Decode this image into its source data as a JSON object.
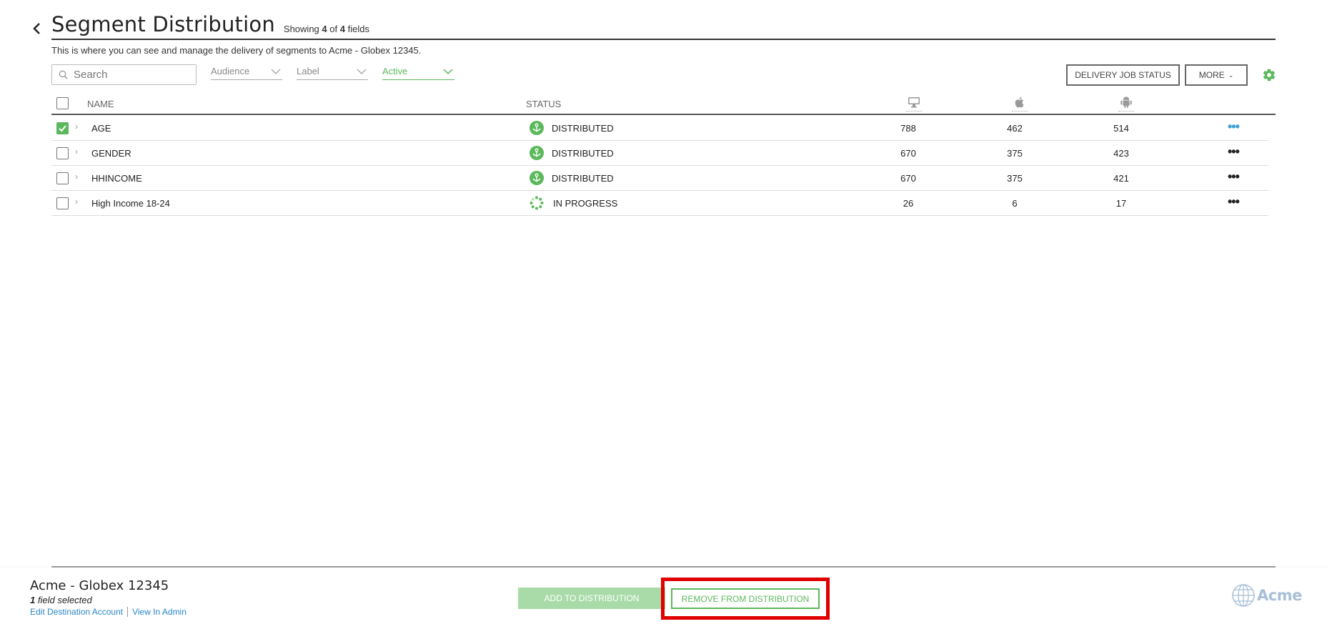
{
  "header": {
    "title": "Segment Distribution",
    "showing_prefix": "Showing",
    "showing_count": "4",
    "showing_of": "of",
    "showing_total": "4",
    "showing_suffix": "fields",
    "subtitle": "This is where you can see and manage the delivery of segments to Acme - Globex 12345."
  },
  "filters": {
    "search_placeholder": "Search",
    "audience": "Audience",
    "label": "Label",
    "active": "Active"
  },
  "toolbar": {
    "delivery_job_status": "DELIVERY JOB STATUS",
    "more": "MORE"
  },
  "table": {
    "columns": {
      "name": "NAME",
      "status": "STATUS"
    },
    "column_icons": [
      "desktop-icon",
      "apple-icon",
      "android-icon"
    ],
    "rows": [
      {
        "name": "AGE",
        "status": "DISTRIBUTED",
        "desktop": "788",
        "apple": "462",
        "android": "514",
        "checked": true
      },
      {
        "name": "GENDER",
        "status": "DISTRIBUTED",
        "desktop": "670",
        "apple": "375",
        "android": "423",
        "checked": false
      },
      {
        "name": "HHINCOME",
        "status": "DISTRIBUTED",
        "desktop": "670",
        "apple": "375",
        "android": "421",
        "checked": false
      },
      {
        "name": "High Income 18-24",
        "status": "IN PROGRESS",
        "desktop": "26",
        "apple": "6",
        "android": "17",
        "checked": false
      }
    ]
  },
  "footer": {
    "account_name": "Acme - Globex 12345",
    "selected_count": "1",
    "selected_suffix": "field selected",
    "edit_link": "Edit Destination Account",
    "view_link": "View In Admin",
    "add_button": "ADD TO DISTRIBUTION",
    "remove_button": "REMOVE FROM DISTRIBUTION",
    "logo_text": "Acme"
  },
  "colors": {
    "accent_green": "#5cb85c",
    "highlight_red": "#e00000",
    "link_blue": "#2a86c7"
  }
}
